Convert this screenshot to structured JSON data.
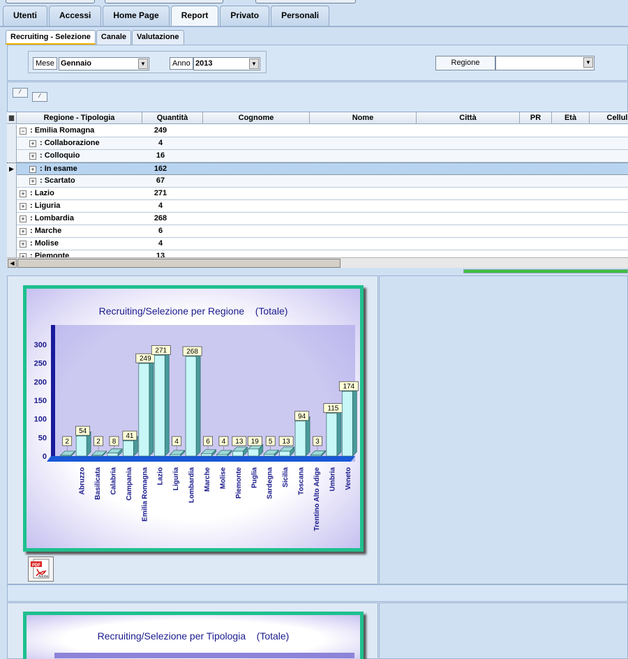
{
  "main_tabs": [
    "Utenti",
    "Accessi",
    "Home Page",
    "Report",
    "Privato",
    "Personali"
  ],
  "main_tab_active": "Report",
  "sub_tabs": [
    "Recruiting - Selezione",
    "Canale",
    "Valutazione"
  ],
  "sub_tab_active": "Recruiting - Selezione",
  "filters": {
    "mese_label": "Mese",
    "mese_value": "Gennaio",
    "anno_label": "Anno",
    "anno_value": "2013",
    "regione_label": "Regione",
    "regione_value": ""
  },
  "grid": {
    "columns": [
      "Regione - Tipologia",
      "Quantità",
      "Cognome",
      "Nome",
      "Città",
      "PR",
      "Età",
      "Cellul"
    ],
    "rows": [
      {
        "label": ": Emilia Romagna",
        "qty": "249",
        "level": 0,
        "expanded": true
      },
      {
        "label": ": Collaborazione",
        "qty": "4",
        "level": 1
      },
      {
        "label": ": Colloquio",
        "qty": "16",
        "level": 1
      },
      {
        "label": ": In esame",
        "qty": "162",
        "level": 1,
        "selected": true
      },
      {
        "label": ": Scartato",
        "qty": "67",
        "level": 1
      },
      {
        "label": ": Lazio",
        "qty": "271",
        "level": 0
      },
      {
        "label": ": Liguria",
        "qty": "4",
        "level": 0
      },
      {
        "label": ": Lombardia",
        "qty": "268",
        "level": 0
      },
      {
        "label": ": Marche",
        "qty": "6",
        "level": 0
      },
      {
        "label": ": Molise",
        "qty": "4",
        "level": 0
      },
      {
        "label": ": Piemonte",
        "qty": "13",
        "level": 0
      }
    ]
  },
  "chart1_title": "Recruiting/Selezione per Regione    (Totale)",
  "chart2_title": "Recruiting/Selezione per Tipologia    (Totale)",
  "pdf_label": "Adobe",
  "colors": {
    "accent_border": "#1ec08e",
    "bar_fill": "#c8f7f7",
    "bar_edge": "#2a6a6a",
    "axis_label": "#1a1a8c"
  },
  "chart_data": {
    "type": "bar",
    "title": "Recruiting/Selezione per Regione    (Totale)",
    "categories": [
      "Abruzzo",
      "Basilicata",
      "Calabria",
      "Campania",
      "Emilia Romagna",
      "Lazio",
      "Liguria",
      "Lombardia",
      "Marche",
      "Molise",
      "Piemonte",
      "Puglia",
      "Sardegna",
      "Sicilia",
      "Toscana",
      "Trentino Alto Adige",
      "Umbria",
      "Veneto"
    ],
    "values": [
      54,
      2,
      8,
      41,
      249,
      271,
      4,
      268,
      6,
      4,
      13,
      19,
      5,
      13,
      94,
      3,
      115,
      174
    ],
    "extra_leading_value": 2,
    "ylim": [
      0,
      300
    ],
    "yticks": [
      0,
      50,
      100,
      150,
      200,
      250,
      300
    ],
    "grid": false,
    "data_labels": true
  }
}
